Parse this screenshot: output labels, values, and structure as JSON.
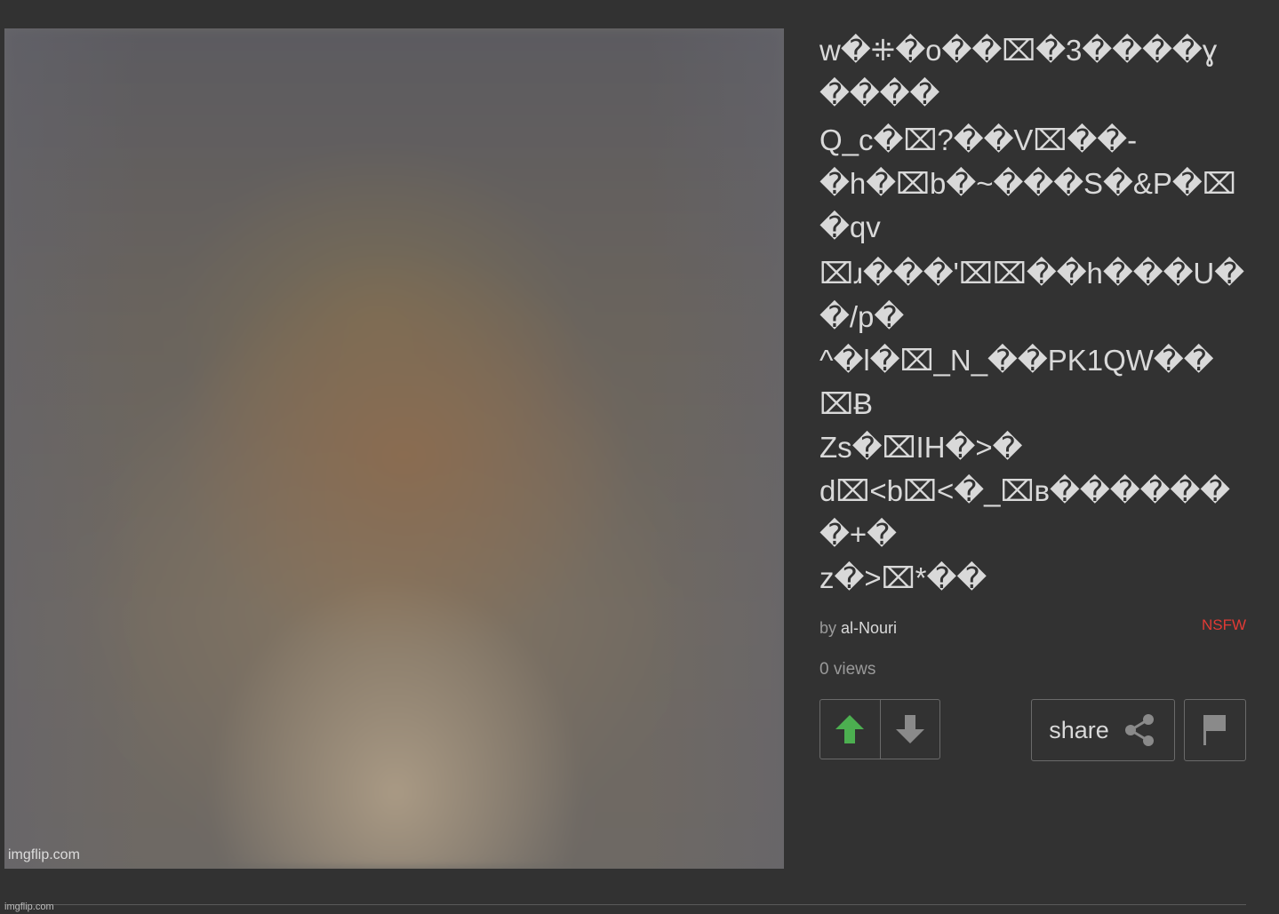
{
  "image": {
    "watermark": "imgflip.com"
  },
  "post": {
    "title_lines": [
      "w�⁜�o��⌧�3����ɣ����",
      "Q_c�⌧?��V⌧��-",
      "�h�⌧b�~���S�&P�⌧�qv",
      "⌧ɹ���'⌧⌧��h���U��/p�",
      "^�l�⌧_N_��PK1QW��⌧Ƀ",
      "Zs�⌧IH�>�",
      "d⌧<b⌧<�_⌧ʙ�������+�",
      "z�>⌧*��"
    ],
    "by_label": "by",
    "author": "al-Nouri",
    "nsfw_label": "NSFW",
    "views": "0 views"
  },
  "actions": {
    "upvote_icon": "arrow-up-icon",
    "downvote_icon": "arrow-down-icon",
    "share_label": "share",
    "share_icon": "share-icon",
    "flag_icon": "flag-icon"
  },
  "colors": {
    "background": "#323232",
    "text": "#d9d9d9",
    "muted": "#9a9a9a",
    "nsfw": "#e23a35",
    "upvote": "#4caf50",
    "border": "#6a6a6a"
  },
  "footer": {
    "watermark": "imgflip.com"
  }
}
